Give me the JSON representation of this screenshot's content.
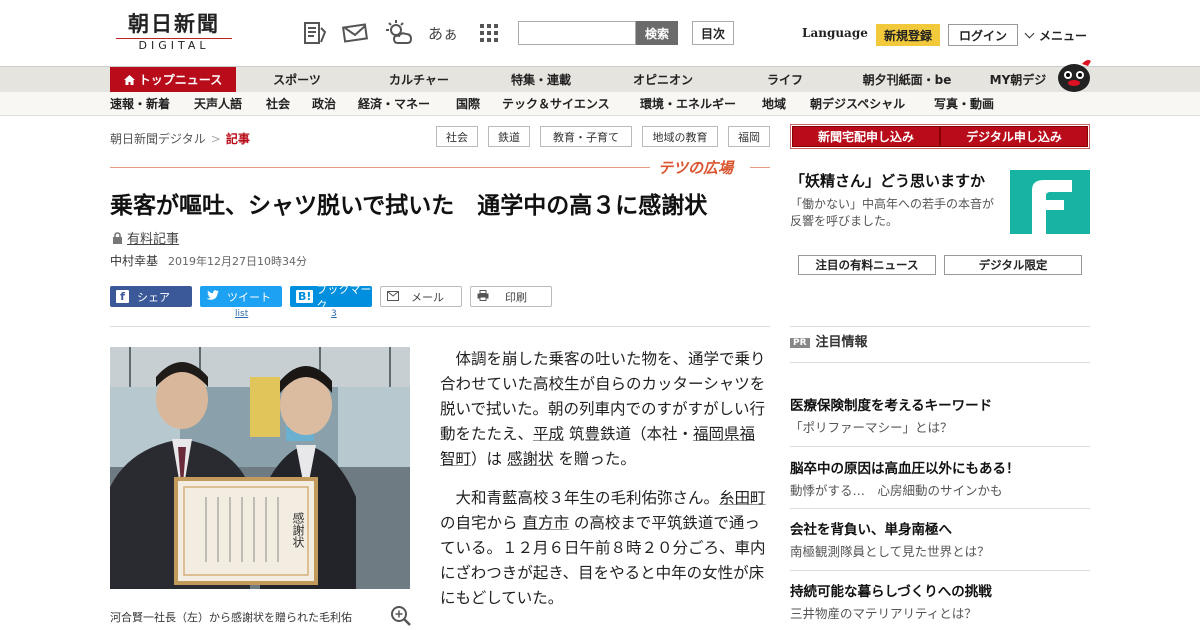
{
  "header": {
    "logo_main": "朝日新聞",
    "logo_sub": "DIGITAL",
    "icons": [
      "newspaper-icon",
      "mail-icon",
      "weather-icon",
      "font-size-icon",
      "grid-icon"
    ],
    "font_size_label": "あぁ",
    "search_placeholder": "",
    "search_button": "検索",
    "index_button": "目次",
    "language": "Language",
    "register": "新規登録",
    "login": "ログイン",
    "menu": "メニュー"
  },
  "nav_primary": {
    "top": "トップニュース",
    "items": [
      "スポーツ",
      "カルチャー",
      "特集・連載",
      "オピニオン",
      "ライフ",
      "朝夕刊紙面・be",
      "MY朝デジ"
    ]
  },
  "nav_secondary": {
    "items": [
      "速報・新着",
      "天声人語",
      "社会",
      "政治",
      "経済・マネー",
      "国際",
      "テック＆サイエンス",
      "環境・エネルギー",
      "地域",
      "朝デジスペシャル",
      "写真・動画"
    ]
  },
  "breadcrumb": {
    "home": "朝日新聞デジタル",
    "sep": ">",
    "current": "記事"
  },
  "tags": [
    "社会",
    "鉄道",
    "教育・子育て",
    "地域の教育",
    "福岡"
  ],
  "section_label": "テツの広場",
  "article": {
    "title": "乗客が嘔吐、シャツ脱いで拭いた　通学中の高３に感謝状",
    "paid_label": "有料記事",
    "author": "中村幸基",
    "date": "2019年12月27日10時34分",
    "share": {
      "facebook": "シェア",
      "twitter": "ツイート",
      "hatena": "ブックマーク",
      "mail": "メール",
      "print": "印刷",
      "twitter_count": "list",
      "hatena_count": "3"
    },
    "photo_caption": "河合賢一社長（左）から感謝状を贈られた毛利佑",
    "certificate_text": "感謝状",
    "p1_a": "体調を崩した乗客の吐いた物を、通学で乗り合わせていた高校生が自らのカッターシャツを脱いで拭いた。朝の列車内でのすがすがしい行動をたたえ、",
    "p1_link1": "平成",
    "p1_b": " 筑豊鉄道（本社・",
    "p1_link2": "福岡県福智町",
    "p1_c": "）は ",
    "p1_link3": "感謝状",
    "p1_d": " を贈った。",
    "p2_a": "大和青藍高校３年生の毛利佑弥さん。",
    "p2_link1": "糸田町",
    "p2_b": " の自宅から ",
    "p2_link2": "直方市",
    "p2_c": " の高校まで平筑鉄道で通っている。１２月６日午前８時２０分ごろ、車内にざわつきが起き、目をやると中年の女性が床にもどしていた。"
  },
  "sidebar": {
    "subscribe_paper": "新聞宅配申し込み",
    "subscribe_digital": "デジタル申し込み",
    "ad_title": "「妖精さん」どう思いますか",
    "ad_text": "「働かない」中高年への若手の本音が反響を呼びました。",
    "btn_paid_news": "注目の有料ニュース",
    "btn_digital_only": "デジタル限定",
    "pr_badge": "PR",
    "pr_heading": "注目情報",
    "pr_items": [
      {
        "head": "医療保険制度を考えるキーワード",
        "sub": "「ポリファーマシー」とは？"
      },
      {
        "head": "脳卒中の原因は高血圧以外にもある！",
        "sub": "動悸がする…　心房細動のサインかも"
      },
      {
        "head": "会社を背負い、単身南極へ",
        "sub": "南極観測隊員として見た世界とは？"
      },
      {
        "head": "持続可能な暮らしづくりへの挑戦",
        "sub": "三井物産のマテリアリティとは？"
      }
    ]
  },
  "colors": {
    "brand_red": "#b80c1a",
    "register_yellow": "#f2c93a",
    "facebook": "#3b5998",
    "twitter": "#1da1f2",
    "hatena": "#008fde",
    "section_orange": "#d9542f",
    "ad_teal": "#17b3a3"
  }
}
